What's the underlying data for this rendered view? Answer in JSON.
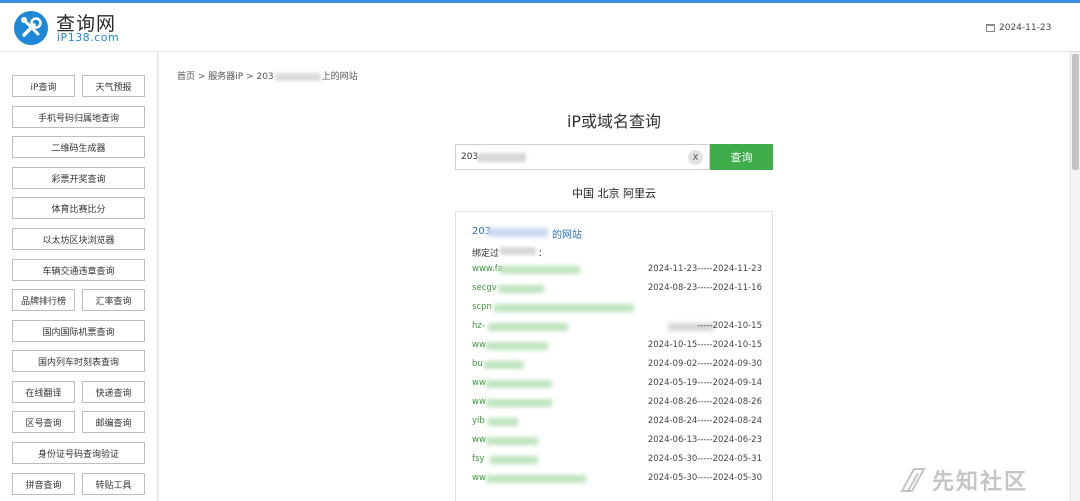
{
  "header": {
    "logo_title": "查询网",
    "logo_sub": "iP138.com",
    "date": "2024-11-23"
  },
  "sidebar": {
    "rows": [
      [
        "iP查询",
        "天气预报"
      ],
      [
        "手机号码归属地查询"
      ],
      [
        "二维码生成器"
      ],
      [
        "彩票开奖查询"
      ],
      [
        "体育比赛比分"
      ],
      [
        "以太坊区块浏览器"
      ],
      [
        "车辆交通违章查询"
      ],
      [
        "品牌排行榜",
        "汇率查询"
      ],
      [
        "国内国际机票查询"
      ],
      [
        "国内列车时刻表查询"
      ],
      [
        "在线翻译",
        "快递查询"
      ],
      [
        "区号查询",
        "邮编查询"
      ],
      [
        "身份证号码查询验证"
      ],
      [
        "拼音查询",
        "转贴工具"
      ]
    ]
  },
  "breadcrumb": {
    "home": "首页",
    "sep1": " > ",
    "server": "服务器iP",
    "sep2": " > ",
    "ip_prefix": "203",
    "suffix": "上的网站"
  },
  "query": {
    "title": "iP或域名查询",
    "input_value": "203.",
    "clear_label": "X",
    "button_label": "查询",
    "location": "中国 北京 阿里云"
  },
  "result": {
    "title_prefix": "203.",
    "title_suffix": "的网站",
    "bind_label": "绑定过",
    "bind_colon": "：",
    "rows": [
      {
        "domain": "www.fa",
        "dates": "2024-11-23-----2024-11-23"
      },
      {
        "domain": "secgv",
        "dates": "2024-08-23-----2024-11-16"
      },
      {
        "domain": "scpn",
        "dates": ""
      },
      {
        "domain": "hz-",
        "dates": "-----2024-10-15"
      },
      {
        "domain": "ww",
        "dates": "2024-10-15-----2024-10-15"
      },
      {
        "domain": "bu",
        "dates": "2024-09-02-----2024-09-30"
      },
      {
        "domain": "ww",
        "dates": "2024-05-19-----2024-09-14"
      },
      {
        "domain": "ww",
        "dates": "2024-08-26-----2024-08-26"
      },
      {
        "domain": "yib",
        "dates": "2024-08-24-----2024-08-24"
      },
      {
        "domain": "ww",
        "dates": "2024-06-13-----2024-06-23"
      },
      {
        "domain": "fsy",
        "dates": "2024-05-30-----2024-05-31"
      },
      {
        "domain": "ww",
        "dates": "2024-05-30-----2024-05-30"
      }
    ]
  },
  "watermark": {
    "text": "先知社区"
  },
  "colors": {
    "accent": "#3d8ee0",
    "search_button": "#3fad4a",
    "domain_link": "#3a9a3a",
    "title_link": "#2570c5"
  }
}
